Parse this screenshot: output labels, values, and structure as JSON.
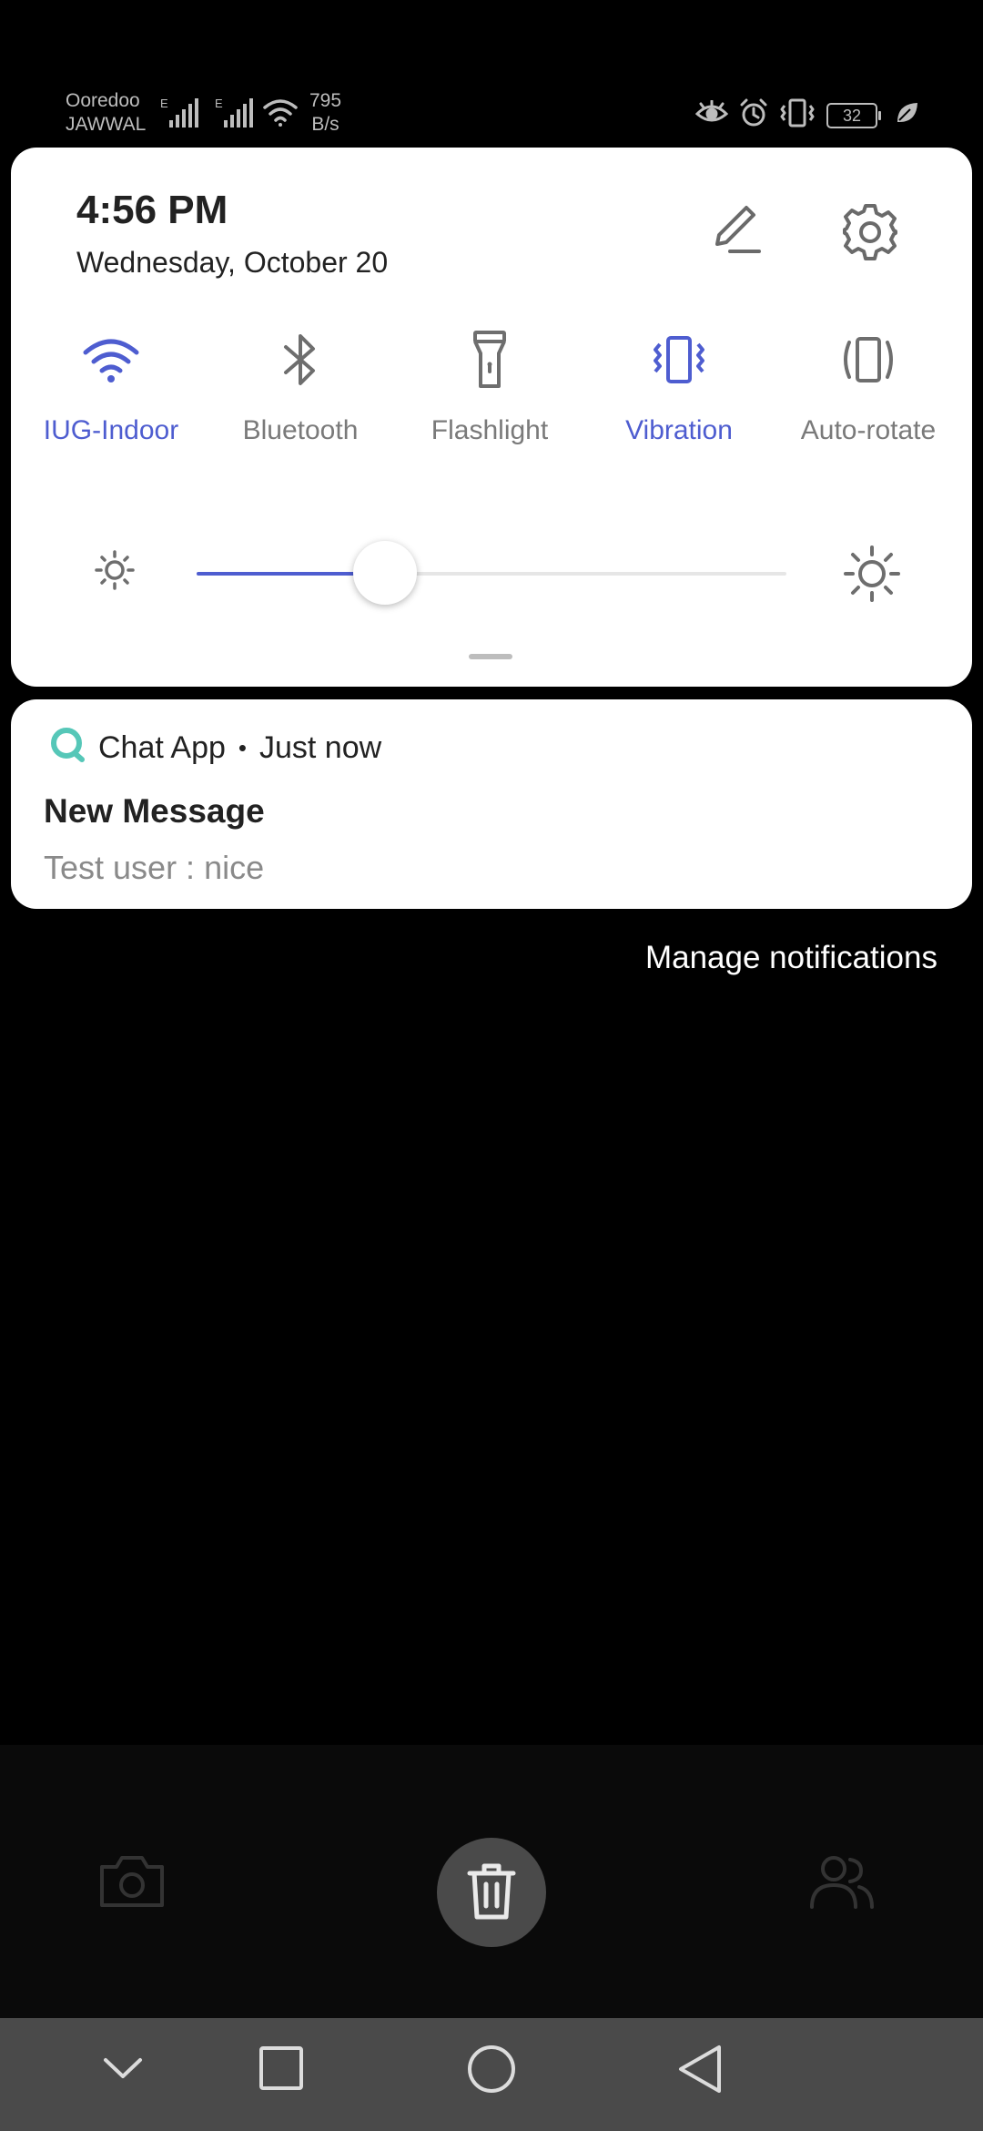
{
  "status_bar": {
    "carrier_1": "Ooredoo",
    "carrier_2": "JAWWAL",
    "net_speed_value": "795",
    "net_speed_unit": "B/s",
    "battery_level": "32"
  },
  "quick_settings": {
    "time": "4:56 PM",
    "date": "Wednesday, October 20",
    "tiles": [
      {
        "label": "IUG-Indoor",
        "icon": "wifi-icon",
        "active": true
      },
      {
        "label": "Bluetooth",
        "icon": "bluetooth-icon",
        "active": false
      },
      {
        "label": "Flashlight",
        "icon": "flashlight-icon",
        "active": false
      },
      {
        "label": "Vibration",
        "icon": "vibration-icon",
        "active": true
      },
      {
        "label": "Auto-rotate",
        "icon": "auto-rotate-icon",
        "active": false
      }
    ],
    "brightness_fraction": 0.32,
    "accent_color": "#4e5dd0"
  },
  "notification": {
    "app_name": "Chat App",
    "separator": "•",
    "time": "Just now",
    "title": "New Message",
    "body": "Test user : nice"
  },
  "manage_notifications_label": "Manage notifications",
  "bottom_tabs": [
    "camera-icon",
    "delete-icon",
    "people-icon"
  ],
  "nav_buttons": [
    "collapse-icon",
    "recents-icon",
    "home-icon",
    "back-icon"
  ]
}
